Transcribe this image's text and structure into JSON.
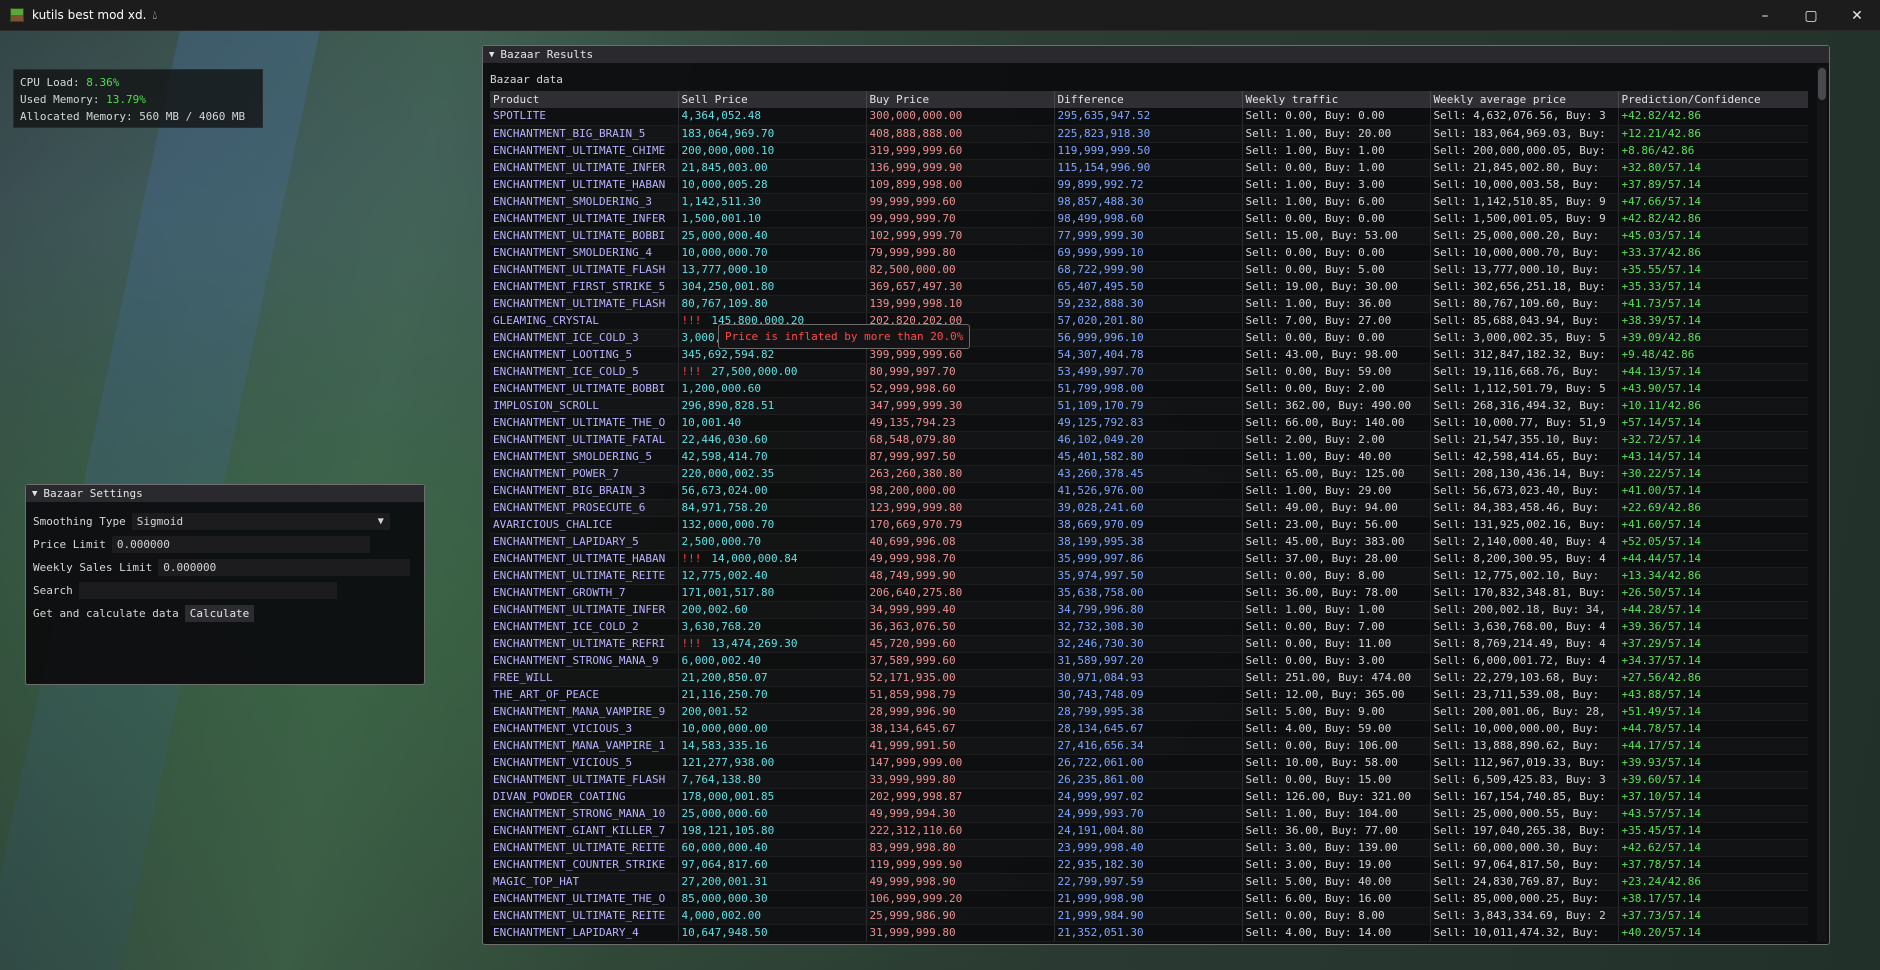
{
  "window": {
    "title": "kutils best mod xd."
  },
  "stats": {
    "cpu_label": "CPU Load:",
    "cpu_value": "8.36%",
    "mem_label": "Used Memory:",
    "mem_value": "13.79%",
    "alloc_label": "Allocated Memory:",
    "alloc_value": "560 MB / 4060 MB"
  },
  "settings": {
    "title": "Bazaar Settings",
    "smoothing_label": "Smoothing Type",
    "smoothing_value": "Sigmoid",
    "price_limit_label": "Price Limit",
    "price_limit_value": "0.000000",
    "weekly_limit_label": "Weekly Sales Limit",
    "weekly_limit_value": "0.000000",
    "search_label": "Search",
    "search_value": "",
    "calc_label": "Get and calculate data",
    "calc_button": "Calculate"
  },
  "results": {
    "title": "Bazaar Results",
    "subtitle": "Bazaar data",
    "tooltip": "Price is inflated by more than 20.0%",
    "inflated_marker": "!!!",
    "columns": [
      "Product",
      "Sell Price",
      "Buy Price",
      "Difference",
      "Weekly traffic",
      "Weekly average price",
      "Prediction/Confidence"
    ],
    "rows": [
      [
        "SPOTLITE",
        "4,364,052.48",
        "300,000,000.00",
        "295,635,947.52",
        "Sell: 0.00, Buy: 0.00",
        "Sell: 4,632,076.56, Buy: 3",
        "+42.82/42.86",
        false
      ],
      [
        "ENCHANTMENT_BIG_BRAIN_5",
        "183,064,969.70",
        "408,888,888.00",
        "225,823,918.30",
        "Sell: 1.00, Buy: 20.00",
        "Sell: 183,064,969.03, Buy:",
        "+12.21/42.86",
        false
      ],
      [
        "ENCHANTMENT_ULTIMATE_CHIME",
        "200,000,000.10",
        "319,999,999.60",
        "119,999,999.50",
        "Sell: 1.00, Buy: 1.00",
        "Sell: 200,000,000.05, Buy:",
        "+8.86/42.86",
        false
      ],
      [
        "ENCHANTMENT_ULTIMATE_INFER",
        "21,845,003.00",
        "136,999,999.90",
        "115,154,996.90",
        "Sell: 0.00, Buy: 1.00",
        "Sell: 21,845,002.80, Buy:",
        "+32.80/57.14",
        false
      ],
      [
        "ENCHANTMENT_ULTIMATE_HABAN",
        "10,000,005.28",
        "109,899,998.00",
        "99,899,992.72",
        "Sell: 1.00, Buy: 3.00",
        "Sell: 10,000,003.58, Buy:",
        "+37.89/57.14",
        false
      ],
      [
        "ENCHANTMENT_SMOLDERING_3",
        "1,142,511.30",
        "99,999,999.60",
        "98,857,488.30",
        "Sell: 1.00, Buy: 6.00",
        "Sell: 1,142,510.85, Buy: 9",
        "+47.66/57.14",
        false
      ],
      [
        "ENCHANTMENT_ULTIMATE_INFER",
        "1,500,001.10",
        "99,999,999.70",
        "98,499,998.60",
        "Sell: 0.00, Buy: 0.00",
        "Sell: 1,500,001.05, Buy: 9",
        "+42.82/42.86",
        false
      ],
      [
        "ENCHANTMENT_ULTIMATE_BOBBI",
        "25,000,000.40",
        "102,999,999.70",
        "77,999,999.30",
        "Sell: 15.00, Buy: 53.00",
        "Sell: 25,000,000.20, Buy:",
        "+45.03/57.14",
        false
      ],
      [
        "ENCHANTMENT_SMOLDERING_4",
        "10,000,000.70",
        "79,999,999.80",
        "69,999,999.10",
        "Sell: 0.00, Buy: 0.00",
        "Sell: 10,000,000.70, Buy:",
        "+33.37/42.86",
        false
      ],
      [
        "ENCHANTMENT_ULTIMATE_FLASH",
        "13,777,000.10",
        "82,500,000.00",
        "68,722,999.90",
        "Sell: 0.00, Buy: 5.00",
        "Sell: 13,777,000.10, Buy:",
        "+35.55/57.14",
        false
      ],
      [
        "ENCHANTMENT_FIRST_STRIKE_5",
        "304,250,001.80",
        "369,657,497.30",
        "65,407,495.50",
        "Sell: 19.00, Buy: 30.00",
        "Sell: 302,656,251.18, Buy:",
        "+35.33/57.14",
        false
      ],
      [
        "ENCHANTMENT_ULTIMATE_FLASH",
        "80,767,109.80",
        "139,999,998.10",
        "59,232,888.30",
        "Sell: 1.00, Buy: 36.00",
        "Sell: 80,767,109.60, Buy:",
        "+41.73/57.14",
        false
      ],
      [
        "GLEAMING_CRYSTAL",
        "145,800,000.20",
        "202,820,202.00",
        "57,020,201.80",
        "Sell: 7.00, Buy: 27.00",
        "Sell: 85,688,043.94, Buy:",
        "+38.39/57.14",
        true
      ],
      [
        "ENCHANTMENT_ICE_COLD_3",
        "3,000,002.40",
        "59,999,998.50",
        "56,999,996.10",
        "Sell: 0.00, Buy: 0.00",
        "Sell: 3,000,002.35, Buy: 5",
        "+39.09/42.86",
        false
      ],
      [
        "ENCHANTMENT_LOOTING_5",
        "345,692,594.82",
        "399,999,999.60",
        "54,307,404.78",
        "Sell: 43.00, Buy: 98.00",
        "Sell: 312,847,182.32, Buy:",
        "+9.48/42.86",
        false
      ],
      [
        "ENCHANTMENT_ICE_COLD_5",
        "27,500,000.00",
        "80,999,997.70",
        "53,499,997.70",
        "Sell: 0.00, Buy: 59.00",
        "Sell: 19,116,668.76, Buy:",
        "+44.13/57.14",
        true
      ],
      [
        "ENCHANTMENT_ULTIMATE_BOBBI",
        "1,200,000.60",
        "52,999,998.60",
        "51,799,998.00",
        "Sell: 0.00, Buy: 2.00",
        "Sell: 1,112,501.79, Buy: 5",
        "+43.90/57.14",
        false
      ],
      [
        "IMPLOSION_SCROLL",
        "296,890,828.51",
        "347,999,999.30",
        "51,109,170.79",
        "Sell: 362.00, Buy: 490.00",
        "Sell: 268,316,494.32, Buy:",
        "+10.11/42.86",
        false
      ],
      [
        "ENCHANTMENT_ULTIMATE_THE_O",
        "10,001.40",
        "49,135,794.23",
        "49,125,792.83",
        "Sell: 66.00, Buy: 140.00",
        "Sell: 10,000.77, Buy: 51,9",
        "+57.14/57.14",
        false
      ],
      [
        "ENCHANTMENT_ULTIMATE_FATAL",
        "22,446,030.60",
        "68,548,079.80",
        "46,102,049.20",
        "Sell: 2.00, Buy: 2.00",
        "Sell: 21,547,355.10, Buy:",
        "+32.72/57.14",
        false
      ],
      [
        "ENCHANTMENT_SMOLDERING_5",
        "42,598,414.70",
        "87,999,997.50",
        "45,401,582.80",
        "Sell: 1.00, Buy: 40.00",
        "Sell: 42,598,414.65, Buy:",
        "+43.14/57.14",
        false
      ],
      [
        "ENCHANTMENT_POWER_7",
        "220,000,002.35",
        "263,260,380.80",
        "43,260,378.45",
        "Sell: 65.00, Buy: 125.00",
        "Sell: 208,130,436.14, Buy:",
        "+30.22/57.14",
        false
      ],
      [
        "ENCHANTMENT_BIG_BRAIN_3",
        "56,673,024.00",
        "98,200,000.00",
        "41,526,976.00",
        "Sell: 1.00, Buy: 29.00",
        "Sell: 56,673,023.40, Buy:",
        "+41.00/57.14",
        false
      ],
      [
        "ENCHANTMENT_PROSECUTE_6",
        "84,971,758.20",
        "123,999,999.80",
        "39,028,241.60",
        "Sell: 49.00, Buy: 94.00",
        "Sell: 84,383,458.46, Buy:",
        "+22.69/42.86",
        false
      ],
      [
        "AVARICIOUS_CHALICE",
        "132,000,000.70",
        "170,669,970.79",
        "38,669,970.09",
        "Sell: 23.00, Buy: 56.00",
        "Sell: 131,925,002.16, Buy:",
        "+41.60/57.14",
        false
      ],
      [
        "ENCHANTMENT_LAPIDARY_5",
        "2,500,000.70",
        "40,699,996.08",
        "38,199,995.38",
        "Sell: 45.00, Buy: 383.00",
        "Sell: 2,140,000.40, Buy: 4",
        "+52.05/57.14",
        false
      ],
      [
        "ENCHANTMENT_ULTIMATE_HABAN",
        "14,000,000.84",
        "49,999,998.70",
        "35,999,997.86",
        "Sell: 37.00, Buy: 28.00",
        "Sell: 8,200,300.95, Buy: 4",
        "+44.44/57.14",
        true
      ],
      [
        "ENCHANTMENT_ULTIMATE_REITE",
        "12,775,002.40",
        "48,749,999.90",
        "35,974,997.50",
        "Sell: 0.00, Buy: 8.00",
        "Sell: 12,775,002.10, Buy:",
        "+13.34/42.86",
        false
      ],
      [
        "ENCHANTMENT_GROWTH_7",
        "171,001,517.80",
        "206,640,275.80",
        "35,638,758.00",
        "Sell: 36.00, Buy: 78.00",
        "Sell: 170,832,348.81, Buy:",
        "+26.50/57.14",
        false
      ],
      [
        "ENCHANTMENT_ULTIMATE_INFER",
        "200,002.60",
        "34,999,999.40",
        "34,799,996.80",
        "Sell: 1.00, Buy: 1.00",
        "Sell: 200,002.18, Buy: 34,",
        "+44.28/57.14",
        false
      ],
      [
        "ENCHANTMENT_ICE_COLD_2",
        "3,630,768.20",
        "36,363,076.50",
        "32,732,308.30",
        "Sell: 0.00, Buy: 7.00",
        "Sell: 3,630,768.00, Buy: 4",
        "+39.36/57.14",
        false
      ],
      [
        "ENCHANTMENT_ULTIMATE_REFRI",
        "13,474,269.30",
        "45,720,999.60",
        "32,246,730.30",
        "Sell: 0.00, Buy: 11.00",
        "Sell: 8,769,214.49, Buy: 4",
        "+37.29/57.14",
        true
      ],
      [
        "ENCHANTMENT_STRONG_MANA_9",
        "6,000,002.40",
        "37,589,999.60",
        "31,589,997.20",
        "Sell: 0.00, Buy: 3.00",
        "Sell: 6,000,001.72, Buy: 4",
        "+34.37/57.14",
        false
      ],
      [
        "FREE_WILL",
        "21,200,850.07",
        "52,171,935.00",
        "30,971,084.93",
        "Sell: 251.00, Buy: 474.00",
        "Sell: 22,279,103.68, Buy:",
        "+27.56/42.86",
        false
      ],
      [
        "THE_ART_OF_PEACE",
        "21,116,250.70",
        "51,859,998.79",
        "30,743,748.09",
        "Sell: 12.00, Buy: 365.00",
        "Sell: 23,711,539.08, Buy:",
        "+43.88/57.14",
        false
      ],
      [
        "ENCHANTMENT_MANA_VAMPIRE_9",
        "200,001.52",
        "28,999,996.90",
        "28,799,995.38",
        "Sell: 5.00, Buy: 9.00",
        "Sell: 200,001.06, Buy: 28,",
        "+51.49/57.14",
        false
      ],
      [
        "ENCHANTMENT_VICIOUS_3",
        "10,000,000.00",
        "38,134,645.67",
        "28,134,645.67",
        "Sell: 4.00, Buy: 59.00",
        "Sell: 10,000,000.00, Buy:",
        "+44.78/57.14",
        false
      ],
      [
        "ENCHANTMENT_MANA_VAMPIRE_1",
        "14,583,335.16",
        "41,999,991.50",
        "27,416,656.34",
        "Sell: 0.00, Buy: 106.00",
        "Sell: 13,888,890.62, Buy:",
        "+44.17/57.14",
        false
      ],
      [
        "ENCHANTMENT_VICIOUS_5",
        "121,277,938.00",
        "147,999,999.00",
        "26,722,061.00",
        "Sell: 10.00, Buy: 58.00",
        "Sell: 112,967,019.33, Buy:",
        "+39.93/57.14",
        false
      ],
      [
        "ENCHANTMENT_ULTIMATE_FLASH",
        "7,764,138.80",
        "33,999,999.80",
        "26,235,861.00",
        "Sell: 0.00, Buy: 15.00",
        "Sell: 6,509,425.83, Buy: 3",
        "+39.60/57.14",
        false
      ],
      [
        "DIVAN_POWDER_COATING",
        "178,000,001.85",
        "202,999,998.87",
        "24,999,997.02",
        "Sell: 126.00, Buy: 321.00",
        "Sell: 167,154,740.85, Buy:",
        "+37.10/57.14",
        false
      ],
      [
        "ENCHANTMENT_STRONG_MANA_10",
        "25,000,000.60",
        "49,999,994.30",
        "24,999,993.70",
        "Sell: 1.00, Buy: 104.00",
        "Sell: 25,000,000.55, Buy:",
        "+43.57/57.14",
        false
      ],
      [
        "ENCHANTMENT_GIANT_KILLER_7",
        "198,121,105.80",
        "222,312,110.60",
        "24,191,004.80",
        "Sell: 36.00, Buy: 77.00",
        "Sell: 197,040,265.38, Buy:",
        "+35.45/57.14",
        false
      ],
      [
        "ENCHANTMENT_ULTIMATE_REITE",
        "60,000,000.40",
        "83,999,998.80",
        "23,999,998.40",
        "Sell: 3.00, Buy: 139.00",
        "Sell: 60,000,000.30, Buy:",
        "+42.62/57.14",
        false
      ],
      [
        "ENCHANTMENT_COUNTER_STRIKE",
        "97,064,817.60",
        "119,999,999.90",
        "22,935,182.30",
        "Sell: 3.00, Buy: 19.00",
        "Sell: 97,064,817.50, Buy:",
        "+37.78/57.14",
        false
      ],
      [
        "MAGIC_TOP_HAT",
        "27,200,001.31",
        "49,999,998.90",
        "22,799,997.59",
        "Sell: 5.00, Buy: 40.00",
        "Sell: 24,830,769.87, Buy:",
        "+23.24/42.86",
        false
      ],
      [
        "ENCHANTMENT_ULTIMATE_THE_O",
        "85,000,000.30",
        "106,999,999.20",
        "21,999,998.90",
        "Sell: 6.00, Buy: 16.00",
        "Sell: 85,000,000.25, Buy:",
        "+38.17/57.14",
        false
      ],
      [
        "ENCHANTMENT_ULTIMATE_REITE",
        "4,000,002.00",
        "25,999,986.90",
        "21,999,984.90",
        "Sell: 0.00, Buy: 8.00",
        "Sell: 3,843,334.69, Buy: 2",
        "+37.73/57.14",
        false
      ],
      [
        "ENCHANTMENT_LAPIDARY_4",
        "10,647,948.50",
        "31,999,999.80",
        "21,352,051.30",
        "Sell: 4.00, Buy: 14.00",
        "Sell: 10,011,474.32, Buy:",
        "+40.20/57.14",
        false
      ]
    ]
  }
}
